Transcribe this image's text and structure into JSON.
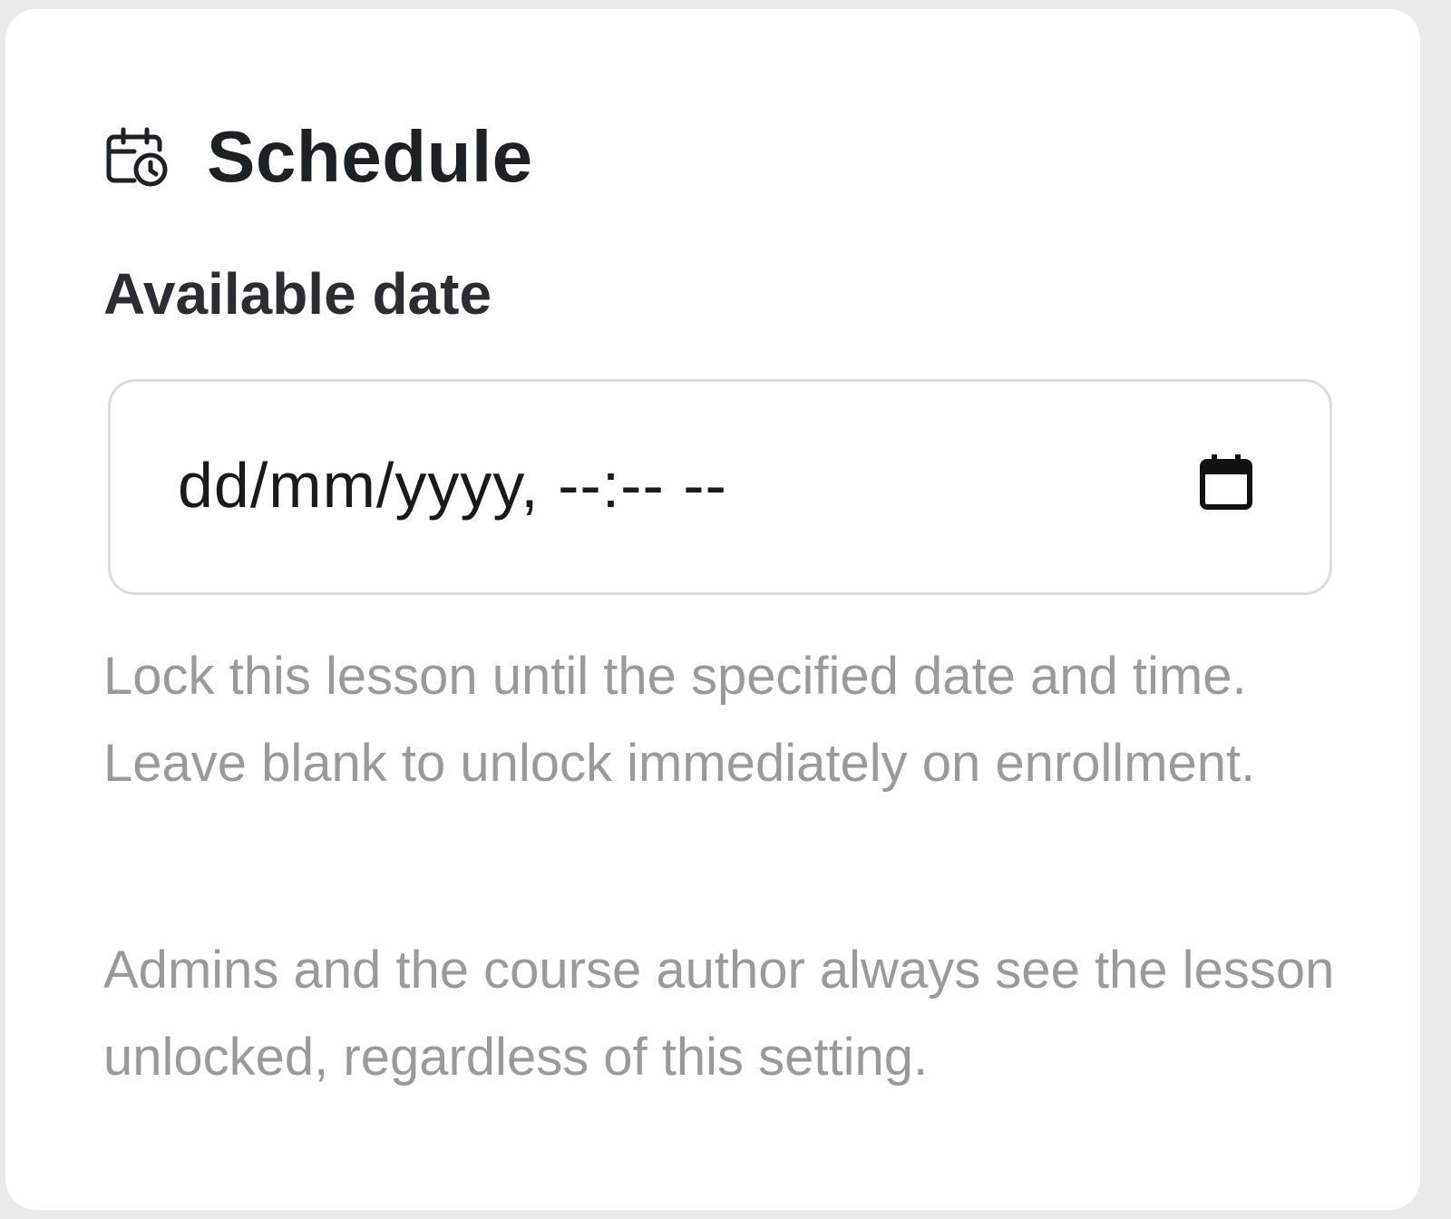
{
  "card": {
    "title": "Schedule",
    "icon": "calendar-clock-icon"
  },
  "available_date": {
    "label": "Available date",
    "value_display": "dd/mm/yyyy, --:-- --",
    "picker_icon": "calendar-icon"
  },
  "help": {
    "paragraph_1": "Lock this lesson until the specified date and time. Leave blank to unlock immediately on enrollment.",
    "paragraph_2": "Admins and the course author always see the lesson unlocked, regardless of this setting."
  },
  "colors": {
    "title": "#1e2124",
    "label": "#2b2d30",
    "help_text": "#9a9a9a",
    "input_border": "#dcdcdc",
    "background": "#eaeaea"
  }
}
